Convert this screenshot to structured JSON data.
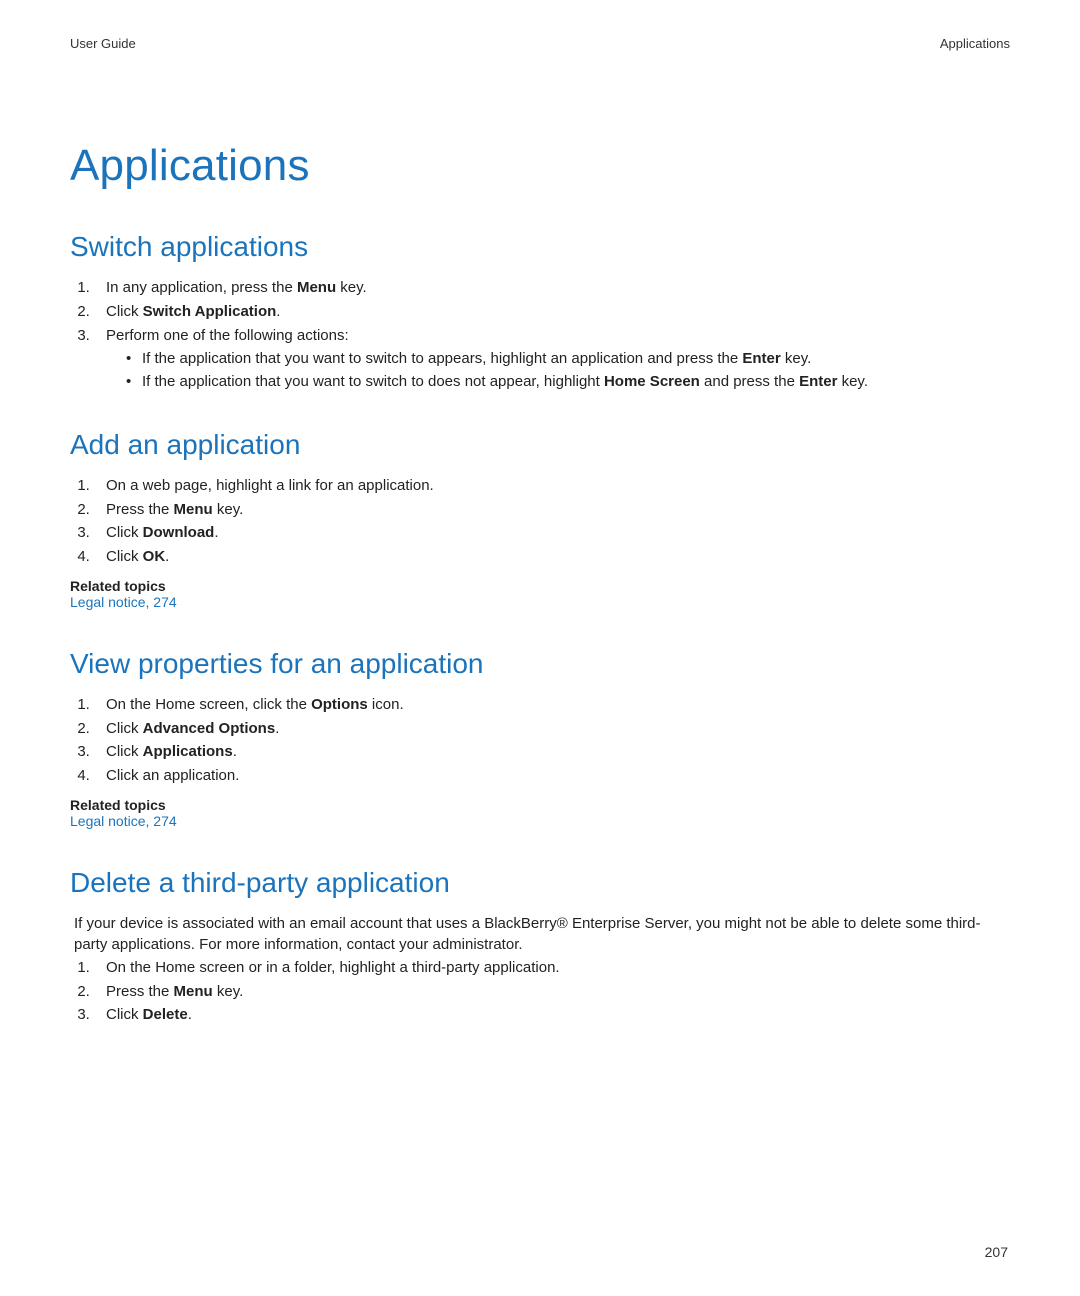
{
  "header": {
    "left": "User Guide",
    "right": "Applications"
  },
  "title": "Applications",
  "page_number": "207",
  "sections": {
    "switch": {
      "heading": "Switch applications",
      "s1a": "In any application, press the ",
      "s1b": "Menu",
      "s1c": " key.",
      "s2a": "Click ",
      "s2b": "Switch Application",
      "s2c": ".",
      "s3": "Perform one of the following actions:",
      "s3_b1a": "If the application that you want to switch to appears, highlight an application and press the ",
      "s3_b1b": "Enter",
      "s3_b1c": " key.",
      "s3_b2a": "If the application that you want to switch to does not appear, highlight ",
      "s3_b2b": "Home Screen",
      "s3_b2c": " and press the ",
      "s3_b2d": "Enter",
      "s3_b2e": " key."
    },
    "add": {
      "heading": "Add an application",
      "s1": "On a web page, highlight a link for an application.",
      "s2a": "Press the ",
      "s2b": "Menu",
      "s2c": " key.",
      "s3a": "Click ",
      "s3b": "Download",
      "s3c": ".",
      "s4a": "Click ",
      "s4b": "OK",
      "s4c": ".",
      "related_head": "Related topics",
      "related_link": "Legal notice, 274"
    },
    "view": {
      "heading": "View properties for an application",
      "s1a": "On the Home screen, click the ",
      "s1b": "Options",
      "s1c": " icon.",
      "s2a": "Click ",
      "s2b": "Advanced Options",
      "s2c": ".",
      "s3a": "Click ",
      "s3b": "Applications",
      "s3c": ".",
      "s4": "Click an application.",
      "related_head": "Related topics",
      "related_link": "Legal notice, 274"
    },
    "delete": {
      "heading": "Delete a third-party application",
      "intro": "If your device is associated with an email account that uses a BlackBerry® Enterprise Server, you might not be able to delete some third-party applications. For more information, contact your administrator.",
      "s1": "On the Home screen or in a folder, highlight a third-party application.",
      "s2a": "Press the ",
      "s2b": "Menu",
      "s2c": " key.",
      "s3a": "Click ",
      "s3b": "Delete",
      "s3c": "."
    }
  }
}
